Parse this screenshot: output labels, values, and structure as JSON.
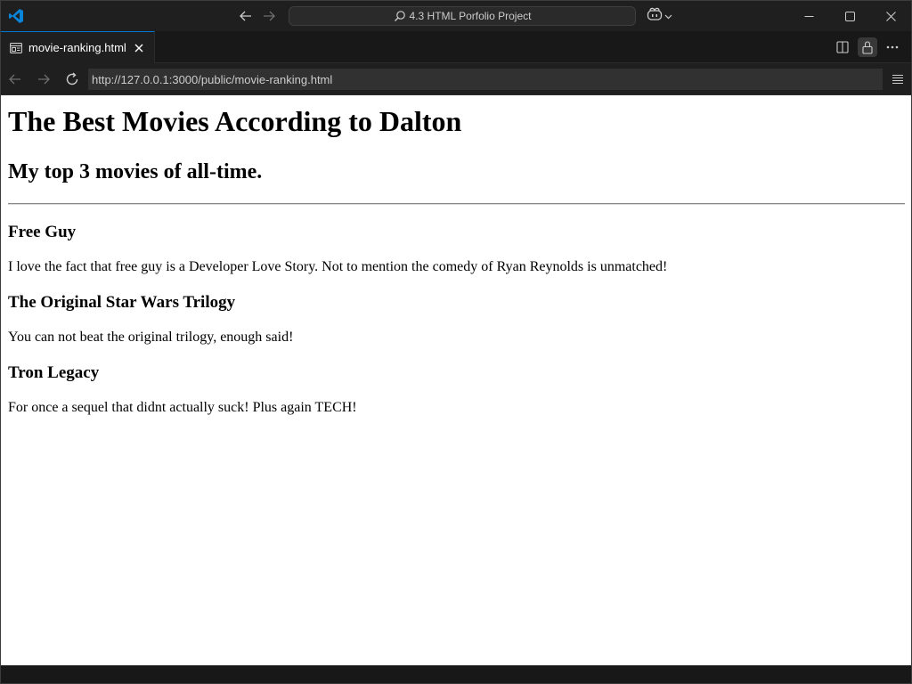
{
  "titlebar": {
    "command_center_text": "4.3 HTML Porfolio Project"
  },
  "tab": {
    "label": "movie-ranking.html"
  },
  "browser": {
    "url": "http://127.0.0.1:3000/public/movie-ranking.html"
  },
  "page": {
    "heading": "The Best Movies According to Dalton",
    "subheading": "My top 3 movies of all-time.",
    "movies": [
      {
        "title": "Free Guy",
        "description": "I love the fact that free guy is a Developer Love Story. Not to mention the comedy of Ryan Reynolds is unmatched!"
      },
      {
        "title": "The Original Star Wars Trilogy",
        "description": "You can not beat the original trilogy, enough said!"
      },
      {
        "title": "Tron Legacy",
        "description": "For once a sequel that didnt actually suck! Plus again TECH!"
      }
    ]
  },
  "icons": {
    "app": "vscode-icon",
    "back": "arrow-left-icon",
    "forward": "arrow-right-icon",
    "search": "search-icon",
    "copilot": "copilot-icon",
    "minimize": "minimize-icon",
    "maximize": "maximize-icon",
    "close": "close-icon",
    "preview": "preview-icon",
    "split": "split-editor-icon",
    "lock": "lock-icon",
    "more": "more-icon",
    "reload": "reload-icon",
    "menu": "menu-icon"
  },
  "colors": {
    "accent": "#0078d4",
    "titlebar_bg": "#1f1f1f",
    "page_bg": "#ffffff"
  }
}
